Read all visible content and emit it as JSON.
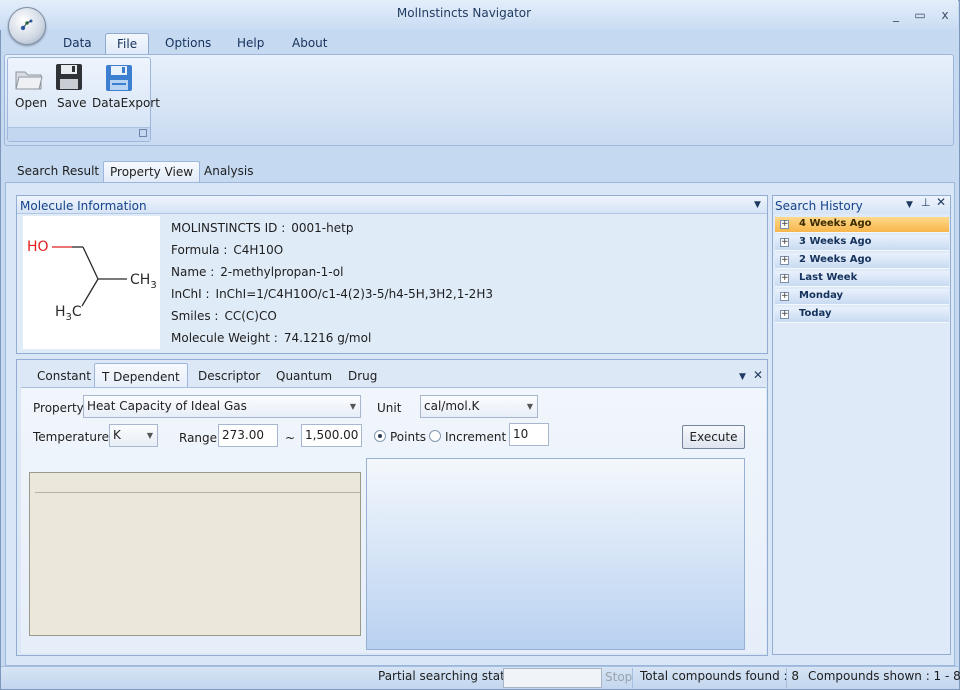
{
  "app": {
    "title": "MolInstincts Navigator"
  },
  "window_controls": {
    "minimize": "_",
    "maximize": "▭",
    "close": "x"
  },
  "ribbon": {
    "tabs": [
      {
        "label": "Data"
      },
      {
        "label": "File"
      },
      {
        "label": "Options"
      },
      {
        "label": "Help"
      },
      {
        "label": "About"
      }
    ],
    "active_tab": "File",
    "buttons": [
      {
        "label": "Open",
        "icon": "open-folder-icon"
      },
      {
        "label": "Save",
        "icon": "floppy-disk-icon"
      },
      {
        "label": "DataExport",
        "icon": "data-export-icon"
      }
    ]
  },
  "view_tabs": [
    {
      "label": "Search Result"
    },
    {
      "label": "Property View"
    },
    {
      "label": "Analysis"
    }
  ],
  "active_view_tab": "Property View",
  "molecule": {
    "panel_title": "Molecule Information",
    "structure_labels": {
      "ho": "HO",
      "ch3_top": "CH",
      "ch3_top_sub": "3",
      "h3c_h": "H",
      "h3c_sub": "3",
      "h3c_c": "C"
    },
    "fields": [
      {
        "label": "MOLINSTINCTS ID :",
        "value": "0001-hetp"
      },
      {
        "label": "Formula :",
        "value": "C4H10O"
      },
      {
        "label": "Name :",
        "value": "2-methylpropan-1-ol"
      },
      {
        "label": "InChI :",
        "value": "InChI=1/C4H10O/c1-4(2)3-5/h4-5H,3H2,1-2H3"
      },
      {
        "label": "Smiles :",
        "value": "CC(C)CO"
      },
      {
        "label": "Molecule Weight :",
        "value": "74.1216 g/mol"
      }
    ]
  },
  "property": {
    "tabs": [
      {
        "label": "Constant"
      },
      {
        "label": "T Dependent"
      },
      {
        "label": "Descriptor"
      },
      {
        "label": "Quantum"
      },
      {
        "label": "Drug"
      }
    ],
    "active_tab": "T Dependent",
    "property_label": "Property",
    "property_value": "Heat Capacity of Ideal Gas",
    "unit_label": "Unit",
    "unit_value": "cal/mol.K",
    "temperature_label": "Temperature",
    "temperature_unit": "K",
    "range_label": "Range",
    "range_from": "273.00",
    "range_sep": "~",
    "range_to": "1,500.00",
    "points_label": "Points",
    "increment_label": "Increment",
    "points_value": "10",
    "mode_selected": "Points",
    "execute_label": "Execute"
  },
  "search_history": {
    "title": "Search History",
    "items": [
      {
        "label": "4 Weeks Ago",
        "selected": true
      },
      {
        "label": "3 Weeks Ago",
        "selected": false
      },
      {
        "label": "2 Weeks Ago",
        "selected": false
      },
      {
        "label": "Last Week",
        "selected": false
      },
      {
        "label": "Monday",
        "selected": false
      },
      {
        "label": "Today",
        "selected": false
      }
    ]
  },
  "status": {
    "partial_label": "Partial searching status :",
    "stop_label": "Stop",
    "total_found": "Total compounds found : 8",
    "shown": "Compounds shown : 1 - 8"
  },
  "colors": {
    "accent": "#15428b",
    "selected_history": "#f7b64c",
    "ho_label": "#e02020"
  }
}
